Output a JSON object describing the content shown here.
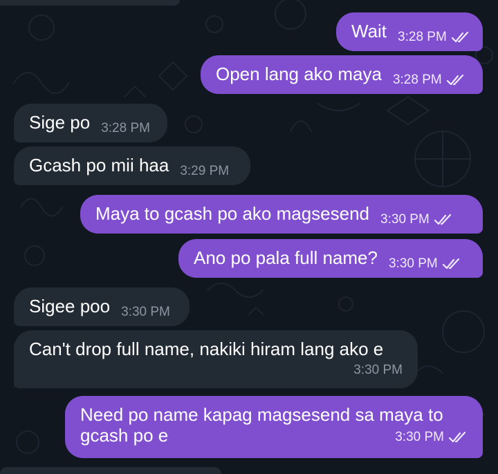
{
  "chat": {
    "messages": [
      {
        "dir": "out",
        "text": "Wait",
        "time": "3:28 PM",
        "read": true
      },
      {
        "dir": "out",
        "text": "Open lang ako maya",
        "time": "3:28 PM",
        "read": true
      },
      {
        "dir": "in",
        "text": "Sige po",
        "time": "3:28 PM"
      },
      {
        "dir": "in",
        "text": "Gcash po mii haa",
        "time": "3:29 PM"
      },
      {
        "dir": "out",
        "text": "Maya to gcash po ako magsesend",
        "time": "3:30 PM",
        "read": true
      },
      {
        "dir": "out",
        "text": "Ano po pala full name?",
        "time": "3:30 PM",
        "read": true
      },
      {
        "dir": "in",
        "text": "Sigee poo",
        "time": "3:30 PM"
      },
      {
        "dir": "in",
        "text": "Can't drop full name, nakiki hiram lang ako e",
        "time": "3:30 PM"
      },
      {
        "dir": "out",
        "text": "Need po name kapag magsesend sa maya to gcash po e",
        "time": "3:30 PM",
        "read": true
      }
    ]
  },
  "colors": {
    "background": "#10171f",
    "outgoing_bubble": "#7f4fd0",
    "incoming_bubble": "#222a34",
    "incoming_time": "#8b96a3"
  },
  "icons": {
    "read_receipt": "double-check-icon",
    "wallpaper": "doodle-pattern"
  }
}
